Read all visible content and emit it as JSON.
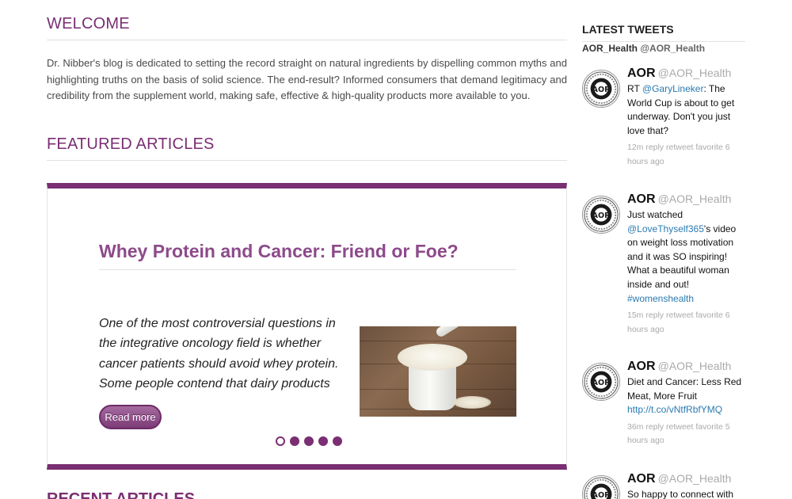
{
  "welcome": {
    "title": "WELCOME",
    "text": "Dr. Nibber's blog is dedicated to setting the record straight on natural ingredients by dispelling common myths and highlighting truths on the basis of solid science. The end-result? Informed consumers that demand legitimacy and credibility from the supplement world, making safe, effective & high-quality products more available to you."
  },
  "featured": {
    "title": "FEATURED ARTICLES",
    "slide": {
      "title": "Whey Protein and Cancer: Friend or Foe?",
      "excerpt": "One of the most controversial questions in the integrative oncology field is whether cancer patients should avoid whey protein. Some people contend that dairy products",
      "image_alt": "scoop of whey protein powder on wooden table",
      "read_more_label": "Read more"
    },
    "dots": [
      {
        "active": true
      },
      {
        "active": false
      },
      {
        "active": false
      },
      {
        "active": false
      },
      {
        "active": false
      }
    ],
    "accent_color": "#7a2e73"
  },
  "recent": {
    "title": "RECENT ARTICLES"
  },
  "sidebar": {
    "title": "LATEST TWEETS",
    "account_name": "AOR_Health",
    "account_handle": "@AOR_Health",
    "tweets": [
      {
        "name": "AOR",
        "handle": "@AOR_Health",
        "parts": [
          {
            "t": "RT "
          },
          {
            "t": "@GaryLineker",
            "link": true
          },
          {
            "t": ": The World Cup is about to get underway. Don't you just love that?"
          }
        ],
        "meta": "12m reply retweet favorite 6 hours ago"
      },
      {
        "name": "AOR",
        "handle": "@AOR_Health",
        "parts": [
          {
            "t": "Just watched "
          },
          {
            "t": "@LoveThyself365",
            "link": true
          },
          {
            "t": "'s video on weight loss motivation and it was SO inspiring! What a beautiful woman inside and out! "
          },
          {
            "t": "#womenshealth",
            "link": true
          }
        ],
        "meta": "15m reply retweet favorite 6 hours ago"
      },
      {
        "name": "AOR",
        "handle": "@AOR_Health",
        "parts": [
          {
            "t": "Diet and Cancer: Less Red Meat, More Fruit "
          },
          {
            "t": "http://t.co/vNtfRbfYMQ",
            "link": true
          }
        ],
        "meta": "36m reply retweet favorite 5 hours ago"
      },
      {
        "name": "AOR",
        "handle": "@AOR_Health",
        "parts": [
          {
            "t": "So happy to connect with"
          }
        ],
        "meta": ""
      }
    ],
    "link_color": "#2a7ab0"
  }
}
